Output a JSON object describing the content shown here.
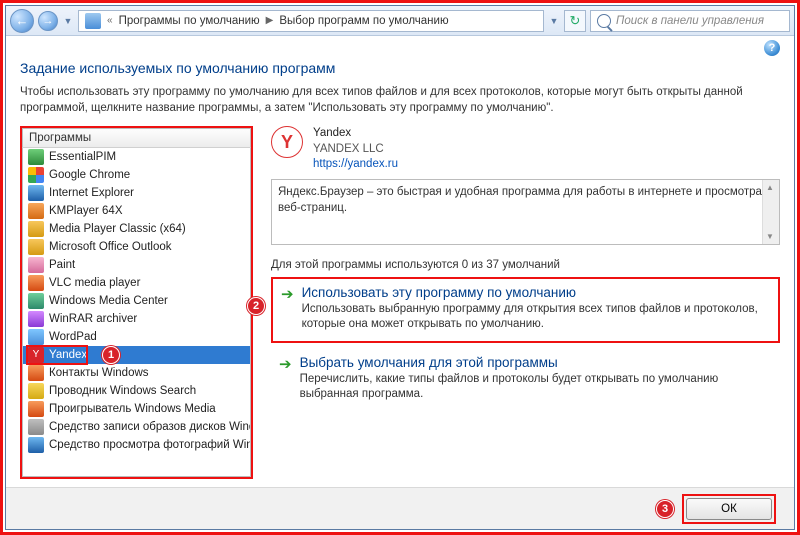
{
  "breadcrumb": {
    "level1": "Программы по умолчанию",
    "level2": "Выбор программ по умолчанию"
  },
  "search": {
    "placeholder": "Поиск в панели управления"
  },
  "title": "Задание используемых по умолчанию программ",
  "intro": "Чтобы использовать эту программу по умолчанию для всех типов файлов и для всех протоколов, которые могут быть открыты данной программой, щелкните название программы, а затем \"Использовать эту программу по умолчанию\".",
  "list_header": "Программы",
  "programs": [
    "EssentialPIM",
    "Google Chrome",
    "Internet Explorer",
    "KMPlayer 64X",
    "Media Player Classic (x64)",
    "Microsoft Office Outlook",
    "Paint",
    "VLC media player",
    "Windows Media Center",
    "WinRAR archiver",
    "WordPad",
    "Yandex",
    "Контакты Windows",
    "Проводник Windows Search",
    "Проигрыватель Windows Media",
    "Средство записи образов дисков Wind...",
    "Средство просмотра фотографий Win..."
  ],
  "selected_index": 11,
  "app": {
    "name": "Yandex",
    "company": "YANDEX LLC",
    "url": "https://yandex.ru",
    "description": "Яндекс.Браузер – это быстрая и удобная программа для работы в интернете и просмотра веб-страниц."
  },
  "usage": "Для этой программы используются 0 из 37 умолчаний",
  "option1": {
    "title": "Использовать эту программу по умолчанию",
    "desc": "Использовать выбранную программу для открытия всех типов файлов и протоколов, которые она может открывать по умолчанию."
  },
  "option2": {
    "title": "Выбрать умолчания для этой программы",
    "desc": "Перечислить, какие типы файлов и протоколы будет открывать по умолчанию выбранная программа."
  },
  "ok": "ОК",
  "callouts": {
    "one": "1",
    "two": "2",
    "three": "3"
  }
}
